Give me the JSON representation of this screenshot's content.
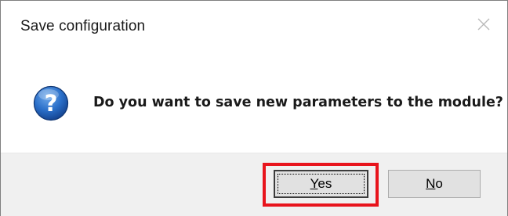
{
  "dialog": {
    "title": "Save configuration",
    "message": "Do you want to save new parameters to the module?",
    "icon": "question-icon",
    "close_icon": "close-icon"
  },
  "buttons": {
    "yes_label": "Yes",
    "no_label": "No"
  },
  "colors": {
    "highlight": "#e8141c",
    "icon_blue": "#1f5fb4",
    "footer_bg": "#f0f0f0",
    "button_bg": "#e1e1e1"
  }
}
